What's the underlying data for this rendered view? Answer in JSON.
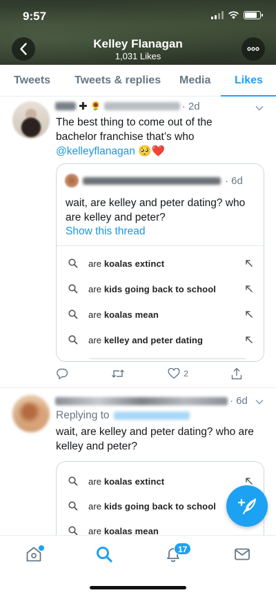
{
  "status_bar": {
    "time": "9:57"
  },
  "header": {
    "name": "Kelley Flanagan",
    "likes": "1,031 Likes"
  },
  "tabs": [
    {
      "label": "Tweets",
      "active": false
    },
    {
      "label": "Tweets & replies",
      "active": false
    },
    {
      "label": "Media",
      "active": false
    },
    {
      "label": "Likes",
      "active": true
    }
  ],
  "tweet1": {
    "time": "· 2d",
    "text_line1": "The best thing to come out of the",
    "text_line2": "bachelor franchise that’s who",
    "mention": "@kelleyflanagan",
    "emoji": "🥺❤️",
    "quote": {
      "time": "· 6d",
      "text": "wait, are kelley and peter dating? who are kelley and peter?",
      "show_thread": "Show this thread",
      "searches": [
        {
          "prefix": "are ",
          "bold": "koalas extinct"
        },
        {
          "prefix": "are ",
          "bold": "kids going back to school"
        },
        {
          "prefix": "are ",
          "bold": "koalas mean"
        },
        {
          "prefix": "are ",
          "bold": "kelley and peter dating"
        }
      ]
    },
    "like_count": "2"
  },
  "tweet2": {
    "time": "· 6d",
    "replying_to": "Replying to",
    "text": "wait, are kelley and peter dating? who are kelley and peter?",
    "searches": [
      {
        "prefix": "are ",
        "bold": "koalas extinct"
      },
      {
        "prefix": "are ",
        "bold": "kids going back to school"
      },
      {
        "prefix": "are ",
        "bold": "koalas mean"
      }
    ]
  },
  "bottom_nav": {
    "notification_count": "17"
  },
  "colors": {
    "accent": "#1da1f2",
    "link": "#1b95e0",
    "muted": "#657786"
  }
}
